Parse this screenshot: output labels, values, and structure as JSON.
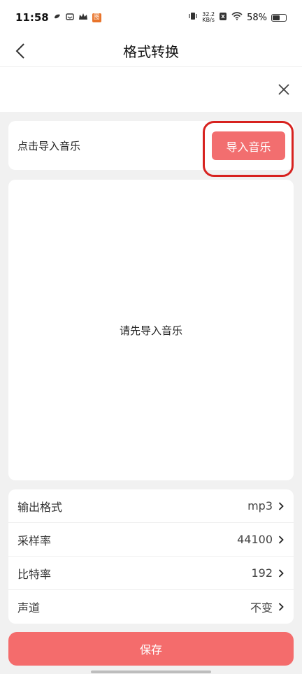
{
  "status_bar": {
    "time": "11:58",
    "net_speed_value": "32.2",
    "net_speed_unit": "KB/s",
    "battery": "58%",
    "battery_level": 0.58,
    "badge": "图"
  },
  "nav": {
    "title": "格式转换"
  },
  "import": {
    "hint": "点击导入音乐",
    "button_label": "导入音乐"
  },
  "empty": {
    "message": "请先导入音乐"
  },
  "settings": [
    {
      "label": "输出格式",
      "value": "mp3"
    },
    {
      "label": "采样率",
      "value": "44100"
    },
    {
      "label": "比特率",
      "value": "192"
    },
    {
      "label": "声道",
      "value": "不变"
    }
  ],
  "save": {
    "label": "保存"
  },
  "colors": {
    "accent": "#f46c6c",
    "highlight": "#d7221f"
  }
}
